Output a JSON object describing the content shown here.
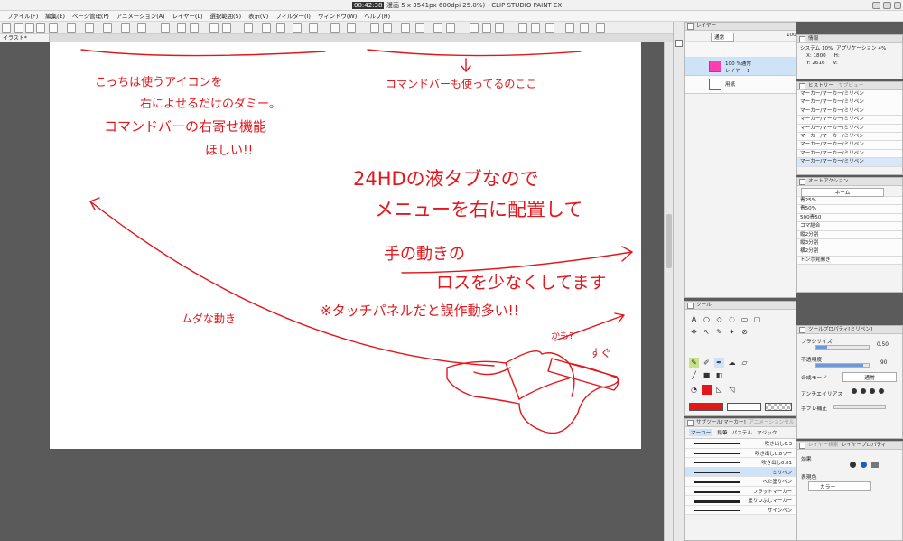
{
  "window": {
    "clock": "00:42:38",
    "title_rest": "-漫画 5 x 3541px 600dpi 25.0%) - CLIP STUDIO PAINT EX"
  },
  "menu": [
    "ファイル(F)",
    "編集(E)",
    "ページ管理(P)",
    "アニメーション(A)",
    "レイヤー(L)",
    "選択範囲(S)",
    "表示(V)",
    "フィルター(I)",
    "ウィンドウ(W)",
    "ヘルプ(H)"
  ],
  "doc_tab": "イラスト*",
  "annotations": {
    "a1": "こっちは使うアイコンを",
    "a2": "右によせるだけのダミー。",
    "a3": "コマンドバーの右寄せ機能",
    "a4": "ほしい!!",
    "a5": "コマンドバーも使ってるのここ",
    "a6": "24HDの液タブなので",
    "a7": "メニューを右に配置して",
    "a8": "手の動きの",
    "a9": "ロスを少なくしてます",
    "a10": "※タッチパネルだと誤作動多い!!",
    "a11": "かも?",
    "a12": "ムダな動き",
    "a13": "すぐ"
  },
  "layer_panel": {
    "tab": "レイヤー",
    "blend": "通常",
    "opacity": "100",
    "layers": [
      {
        "name": "100 %通常",
        "sub": "レイヤー 1"
      },
      {
        "name": "用紙",
        "sub": ""
      }
    ]
  },
  "nav_panel": {
    "tab": "情報",
    "system": "システム 10%",
    "application": "アプリケーション 4%",
    "x": "X: 1800",
    "y": "Y: 2616",
    "h": "H:",
    "v": "V:"
  },
  "history_panel": {
    "tabs": [
      "ヒストリー",
      "サブビュー"
    ],
    "items": [
      "マーカー/マーカー/ミリペン",
      "マーカー/マーカー/ミリペン",
      "マーカー/マーカー/ミリペン",
      "マーカー/マーカー/ミリペン",
      "マーカー/マーカー/ミリペン",
      "マーカー/マーカー/ミリペン",
      "マーカー/マーカー/ミリペン",
      "マーカー/マーカー/ミリペン",
      "マーカー/マーカー/ミリペン"
    ]
  },
  "auto_action": {
    "tab": "オートアクション",
    "set": "ネーム",
    "items": [
      "青25%",
      "青50%",
      "500青50",
      "コマ結合",
      "縦2分割",
      "縦3分割",
      "横2分割",
      "トンボ見開き"
    ]
  },
  "tool_panel": {
    "tab": "ツール"
  },
  "tool_property": {
    "tab": "ツールプロパティ[ミリペン]",
    "brush_size_label": "ブラシサイズ",
    "brush_size": "0.50",
    "opacity_label": "不透明度",
    "opacity": "90",
    "blend_label": "合成モード",
    "blend_value": "通常",
    "aa_label": "アンチエイリアス",
    "stabilize_label": "手ブレ補正"
  },
  "subtool_panel": {
    "tabs": [
      "サブツール[マーカー]",
      "アニメーションセル"
    ],
    "groups": [
      "マーカー",
      "鉛筆",
      "パステル",
      "マジック"
    ],
    "brushes": [
      "吹き出し0.3",
      "吹き出し0.8ワー",
      "吹き出し0.81",
      "ミリペン",
      "べた塗りペン",
      "フラットマーカー",
      "塗りつぶしマーカー",
      "サインペン"
    ],
    "selected": 3
  },
  "layer_property": {
    "tabs": [
      "レイヤー検索",
      "レイヤープロパティ"
    ],
    "effect_label": "効果",
    "color_label": "表現色",
    "color_value": "カラー"
  },
  "colors": {
    "ink": "#e4161b",
    "main_color": "#e01818",
    "accent": "#1c5fb8"
  }
}
